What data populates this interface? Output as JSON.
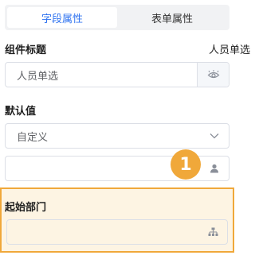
{
  "tabs": [
    {
      "label": "字段属性",
      "active": true
    },
    {
      "label": "表单属性",
      "active": false
    }
  ],
  "component_title": {
    "label": "组件标题",
    "value_display": "人员单选",
    "input_value": "人员单选",
    "icon": "eye-icon"
  },
  "default_value": {
    "label": "默认值",
    "select_value": "自定义",
    "select_icon": "chevron-down-icon",
    "user_input_value": "",
    "user_icon": "user-icon"
  },
  "step_badge": "1",
  "start_department": {
    "label": "起始部门",
    "input_value": "",
    "icon": "org-chart-icon"
  },
  "colors": {
    "accent": "#2f73f0",
    "highlight_border": "#f0a83a",
    "highlight_bg": "#fdf4e3"
  }
}
